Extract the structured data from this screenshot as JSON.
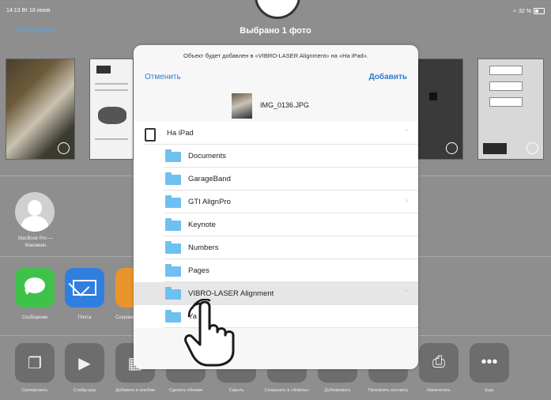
{
  "status_bar": {
    "time_date": "14:13  Вт 18 июня",
    "battery_text": "32 %"
  },
  "share_sheet": {
    "cancel_label": "Отменить",
    "title": "Выбрано 1 фото",
    "airdrop_device": "MacBook Pro — Маковкин",
    "apps": [
      {
        "label": "Сообщение",
        "icon": "messages-icon"
      },
      {
        "label": "Почта",
        "icon": "mail-icon"
      },
      {
        "label": "Сохранить в «Ф...",
        "icon": "files-icon"
      }
    ],
    "actions": [
      {
        "label": "Скопировать",
        "icon": "copy-icon"
      },
      {
        "label": "Слайд-шоу",
        "icon": "play-icon"
      },
      {
        "label": "Добавить в альбом",
        "icon": "album-icon"
      },
      {
        "label": "Сделать обоями",
        "icon": "wallpaper-icon"
      },
      {
        "label": "Скрыть",
        "icon": "hide-icon"
      },
      {
        "label": "Сохранить в «Файлы»",
        "icon": "files-icon"
      },
      {
        "label": "Дублировать",
        "icon": "duplicate-icon"
      },
      {
        "label": "Присвоить контакту",
        "icon": "contact-icon"
      },
      {
        "label": "Напечатать",
        "icon": "print-icon"
      },
      {
        "label": "Еще",
        "icon": "more-icon"
      }
    ]
  },
  "dialog": {
    "message": "Объект будет добавлен в «VIBRO-LASER Alignment» на «На iPad».",
    "cancel_label": "Отменить",
    "add_label": "Добавить",
    "file_name": "IMG_0136.JPG",
    "location": "На iPad",
    "folders": [
      {
        "name": "Documents"
      },
      {
        "name": "GarageBand"
      },
      {
        "name": "GTI AlignPro",
        "has_chevron": true
      },
      {
        "name": "Keynote"
      },
      {
        "name": "Numbers"
      },
      {
        "name": "Pages"
      },
      {
        "name": "VIBRO-LASER Alignment",
        "selected": true,
        "has_chevron": true
      },
      {
        "name": "Ya"
      }
    ]
  },
  "colors": {
    "link_blue": "#2e7bd0",
    "folder_blue": "#6ec0f0",
    "selection_bg": "#e6e6e6"
  }
}
